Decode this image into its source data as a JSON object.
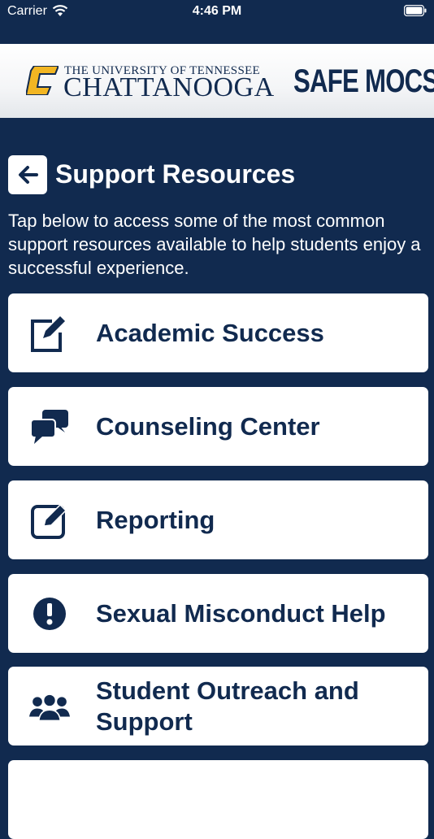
{
  "status_bar": {
    "carrier": "Carrier",
    "time": "4:46 PM"
  },
  "header": {
    "university_line1": "THE UNIVERSITY OF TENNESSEE",
    "university_line2": "CHATTANOOGA",
    "app_name": "SAFE MOCS",
    "colors": {
      "gold": "#f2b623",
      "navy": "#112a4f"
    }
  },
  "page": {
    "title": "Support Resources",
    "intro": "Tap below to access some of the most common support resources available to help students enjoy a successful experience."
  },
  "resources": [
    {
      "label": "Academic Success",
      "icon": "edit-square-icon"
    },
    {
      "label": "Counseling Center",
      "icon": "chat-bubbles-icon"
    },
    {
      "label": "Reporting",
      "icon": "edit-box-icon"
    },
    {
      "label": "Sexual Misconduct Help",
      "icon": "exclamation-circle-icon"
    },
    {
      "label": "Student Outreach and Support",
      "icon": "users-icon"
    }
  ]
}
